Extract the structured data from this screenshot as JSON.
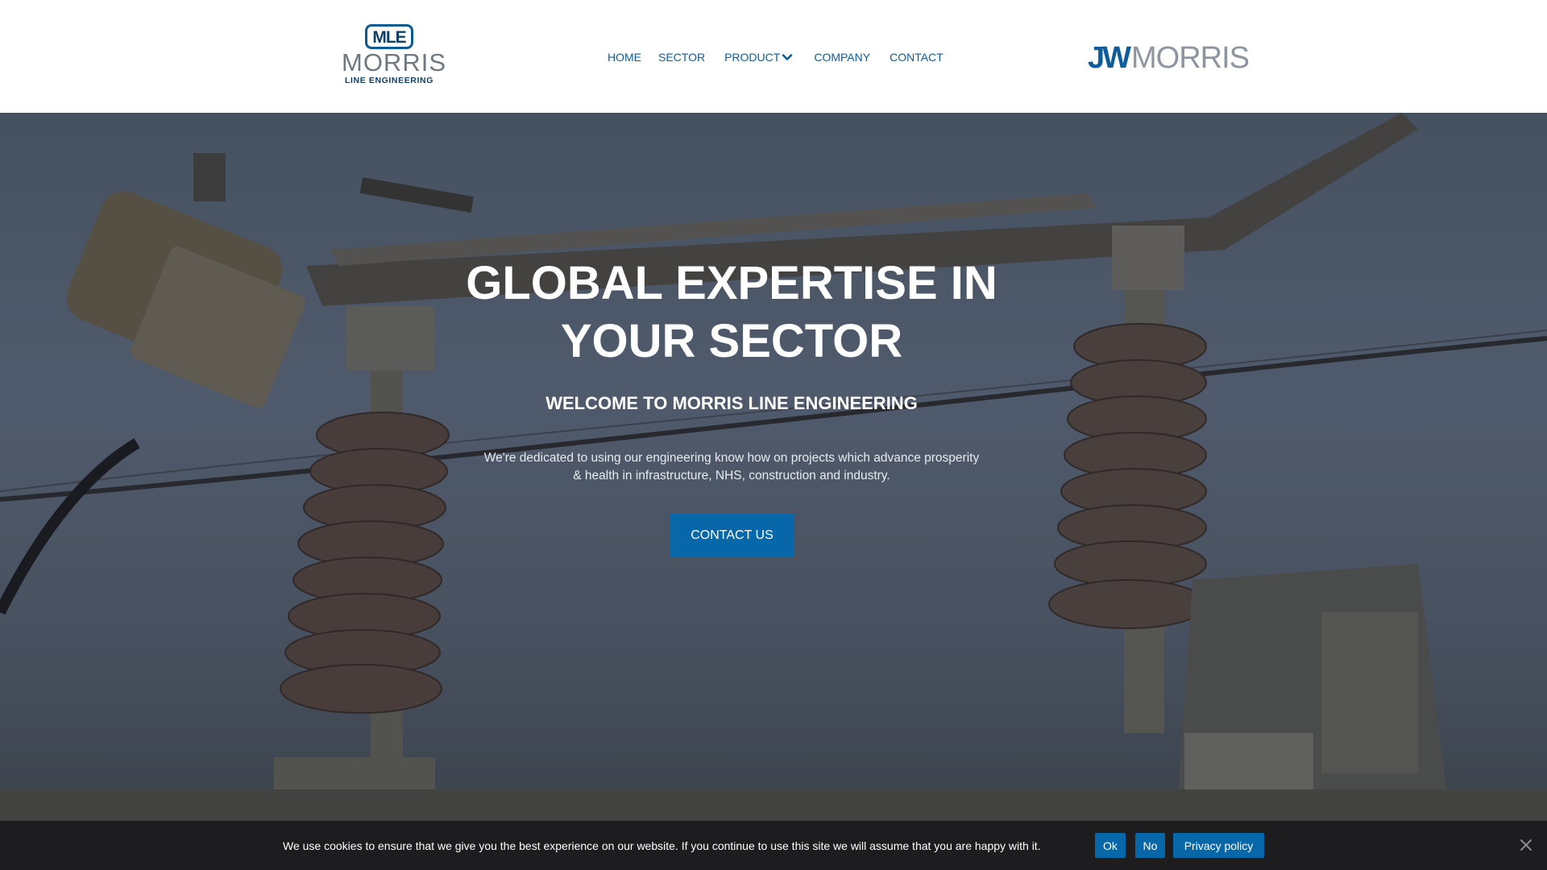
{
  "header": {
    "logo_left": {
      "badge": "MLE",
      "name": "MORRIS",
      "sub": "LINE ENGINEERING"
    },
    "nav": [
      {
        "label": "HOME"
      },
      {
        "label": "SECTOR"
      },
      {
        "label": "PRODUCT",
        "icon": "chevron-down-icon"
      },
      {
        "label": "COMPANY"
      },
      {
        "label": "CONTACT"
      }
    ],
    "logo_right": {
      "jw": "JW",
      "morris": "MORRIS"
    }
  },
  "hero": {
    "title": "GLOBAL EXPERTISE IN YOUR SECTOR",
    "subtitle": "WELCOME TO MORRIS LINE ENGINEERING",
    "description": "We're dedicated to using our engineering know how on projects which advance prosperity & health in infrastructure, NHS, construction and industry.",
    "cta_label": "CONTACT US"
  },
  "cookie_bar": {
    "text": "We use cookies to ensure that we give you the best experience on our website. If you continue to use this site we will assume that you are happy with it.",
    "ok_label": "Ok",
    "no_label": "No",
    "privacy_label": "Privacy policy",
    "close_icon": "close-icon"
  },
  "colors": {
    "brand_blue": "#0767a9",
    "nav_text": "#0d5d9b",
    "logo_grey": "#8d96a0",
    "cookie_bg": "#1d1d1f"
  }
}
